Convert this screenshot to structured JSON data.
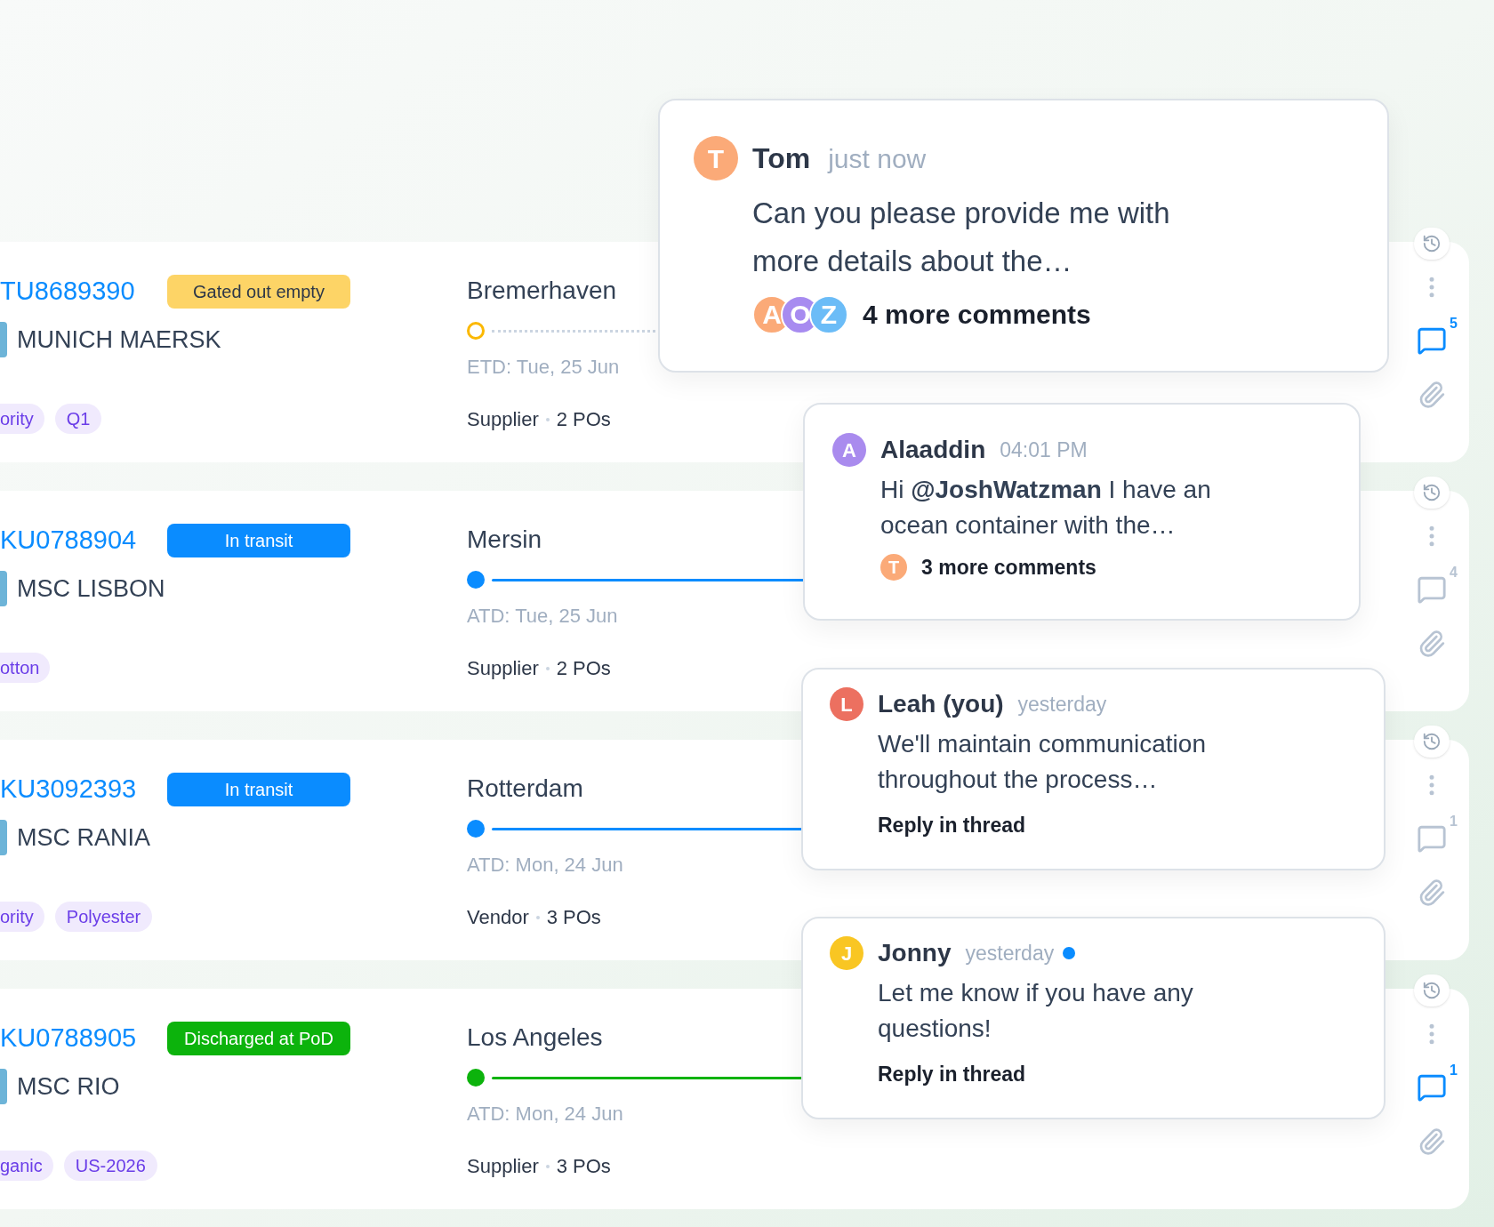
{
  "shipments": [
    {
      "container": "TU8689390",
      "status": {
        "label": "Gated out empty",
        "kind": "gated"
      },
      "vessel": "MUNICH MAERSK",
      "tags": [
        "ority",
        "Q1"
      ],
      "port": "Bremerhaven",
      "progress": {
        "kind": "pending"
      },
      "departure": "ETD: Tue, 25 Jun",
      "party": "Supplier",
      "orders": "2 POs",
      "comments": {
        "count": "5",
        "unread": true
      }
    },
    {
      "container": "KU0788904",
      "status": {
        "label": "In transit",
        "kind": "transit"
      },
      "vessel": "MSC LISBON",
      "tags": [
        "otton"
      ],
      "port": "Mersin",
      "progress": {
        "kind": "transit"
      },
      "departure": "ATD: Tue, 25 Jun",
      "party": "Supplier",
      "orders": "2 POs",
      "comments": {
        "count": "4",
        "unread": false
      }
    },
    {
      "container": "KU3092393",
      "status": {
        "label": "In transit",
        "kind": "transit"
      },
      "vessel": "MSC RANIA",
      "tags": [
        "ority",
        "Polyester"
      ],
      "port": "Rotterdam",
      "progress": {
        "kind": "transit"
      },
      "departure": "ATD: Mon, 24 Jun",
      "party": "Vendor",
      "orders": "3 POs",
      "comments": {
        "count": "1",
        "unread": false
      }
    },
    {
      "container": "KU0788905",
      "status": {
        "label": "Discharged at PoD",
        "kind": "discharged"
      },
      "vessel": "MSC RIO",
      "tags": [
        "ganic",
        "US-2026"
      ],
      "port": "Los Angeles",
      "progress": {
        "kind": "discharged"
      },
      "departure": "ATD: Mon, 24 Jun",
      "party": "Supplier",
      "orders": "3 POs",
      "comments": {
        "count": "1",
        "unread": true
      }
    }
  ],
  "comment_popups": [
    {
      "author": "Tom",
      "time": "just now",
      "unread": false,
      "avatar": {
        "letter": "T",
        "color": "#fbaa78"
      },
      "text": "Can you please provide me with more details about the…",
      "footer": {
        "kind": "participants",
        "avatars": [
          {
            "letter": "A",
            "color": "#fbaa78"
          },
          {
            "letter": "O",
            "color": "#a78bf0"
          },
          {
            "letter": "Z",
            "color": "#6bbcf7"
          }
        ],
        "label": "4 more comments"
      }
    },
    {
      "author": "Alaaddin",
      "time": "04:01 PM",
      "unread": false,
      "avatar": {
        "letter": "A",
        "color": "#a98bee"
      },
      "text": "Hi **@JoshWatzman** I have an ocean container with the…",
      "footer": {
        "kind": "participants",
        "avatars": [
          {
            "letter": "T",
            "color": "#fbaa78"
          }
        ],
        "label": "3 more comments"
      }
    },
    {
      "author": "Leah (you)",
      "time": "yesterday",
      "unread": false,
      "avatar": {
        "letter": "L",
        "color": "#ec7060"
      },
      "text": "We'll maintain communication throughout the process…",
      "footer": {
        "kind": "reply",
        "label": "Reply in thread"
      }
    },
    {
      "author": "Jonny",
      "time": "yesterday",
      "unread": true,
      "avatar": {
        "letter": "J",
        "color": "#f9c623"
      },
      "text": "Let me know if you have any questions!",
      "footer": {
        "kind": "reply",
        "label": "Reply in thread"
      }
    }
  ]
}
